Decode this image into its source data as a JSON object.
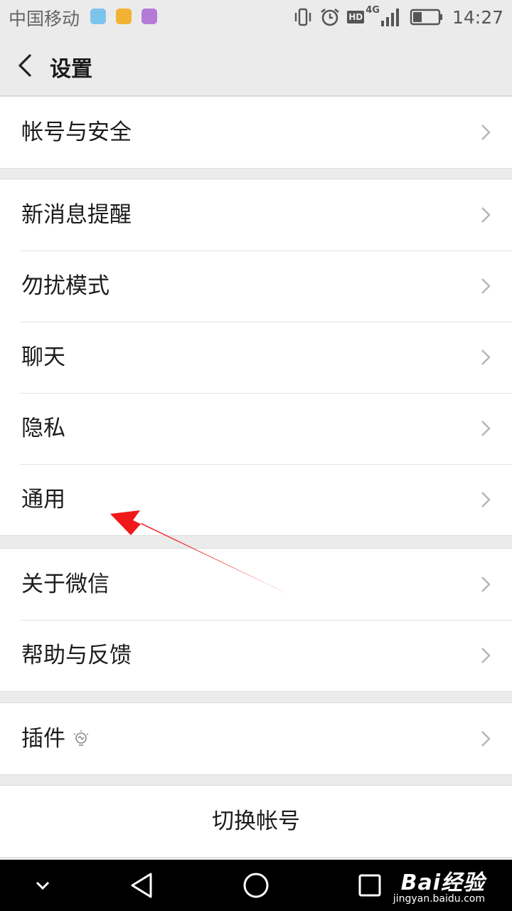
{
  "status_bar": {
    "carrier": "中国移动",
    "network": "4G",
    "hd": "HD",
    "time": "14:27"
  },
  "header": {
    "title": "设置"
  },
  "groups": [
    {
      "items": [
        {
          "label": "帐号与安全"
        }
      ]
    },
    {
      "items": [
        {
          "label": "新消息提醒"
        },
        {
          "label": "勿扰模式"
        },
        {
          "label": "聊天"
        },
        {
          "label": "隐私"
        },
        {
          "label": "通用"
        }
      ]
    },
    {
      "items": [
        {
          "label": "关于微信"
        },
        {
          "label": "帮助与反馈"
        }
      ]
    },
    {
      "items": [
        {
          "label": "插件"
        }
      ]
    }
  ],
  "switch_account": {
    "label": "切换帐号"
  },
  "watermark": {
    "main": "Bai经验",
    "sub": "jingyan.baidu.com"
  },
  "colors": {
    "annotation_arrow": "#f01818",
    "page_bg": "#ebebeb"
  }
}
